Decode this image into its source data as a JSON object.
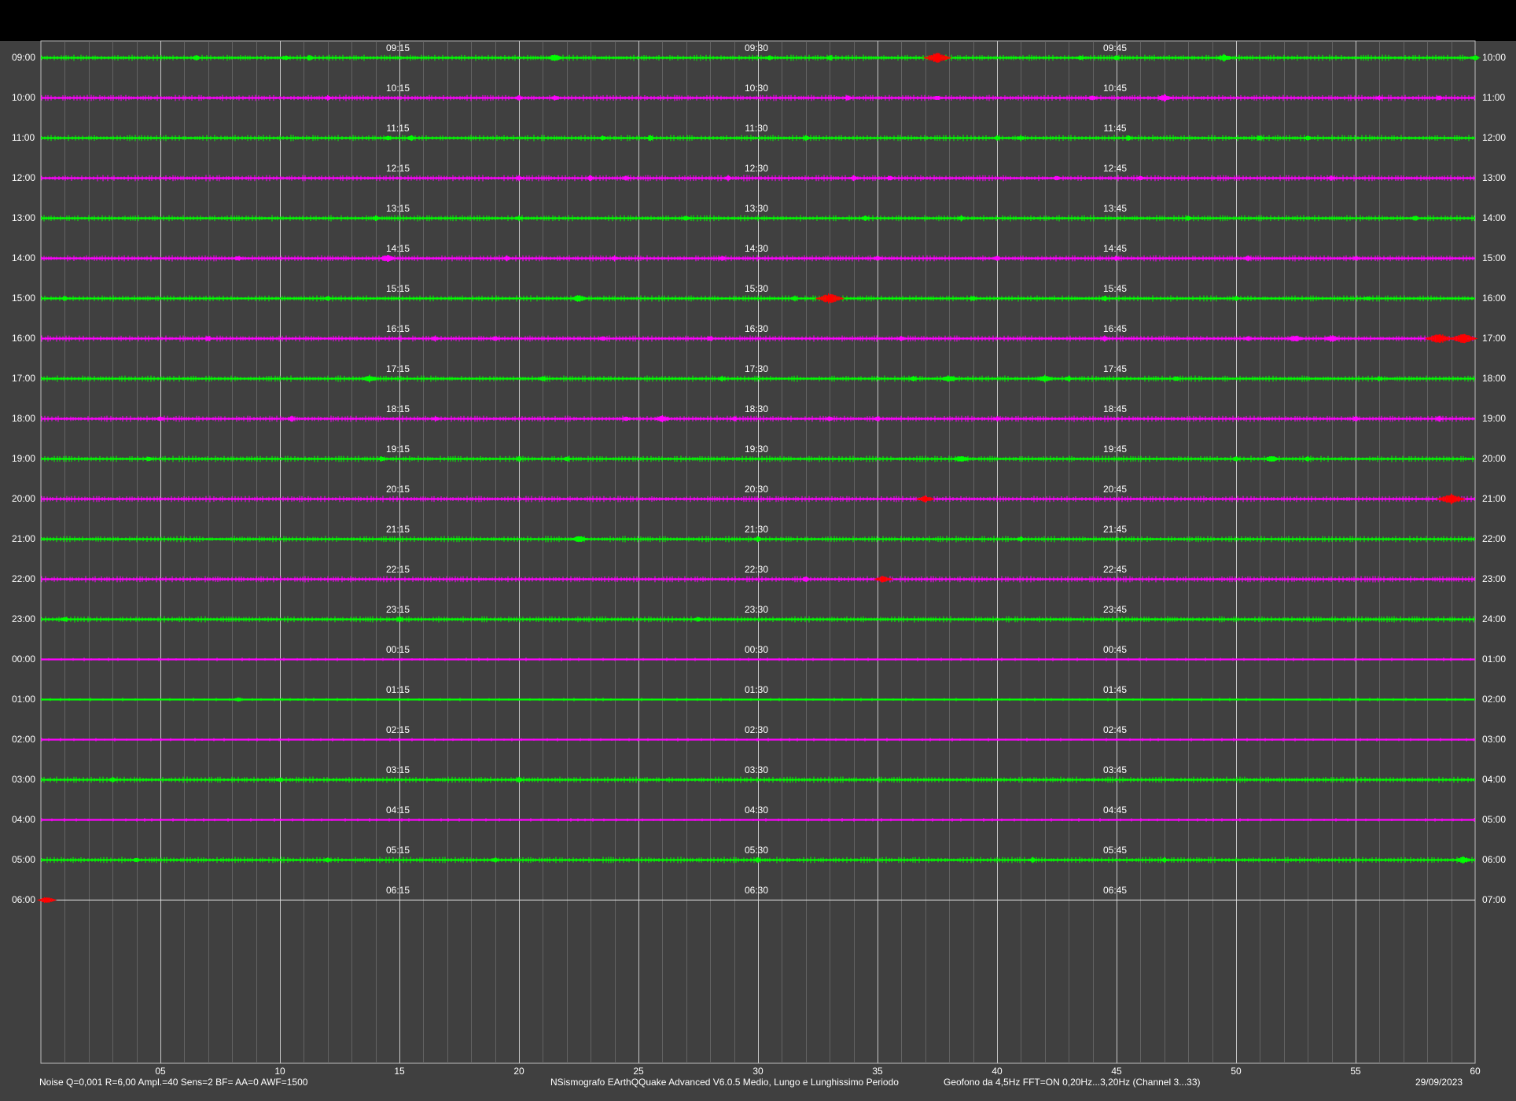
{
  "chart_data": {
    "type": "line",
    "x_ticks": [
      "05",
      "10",
      "15",
      "20",
      "25",
      "30",
      "35",
      "40",
      "45",
      "50",
      "55",
      "60"
    ],
    "x_range_minutes": [
      0,
      60
    ],
    "rows": [
      {
        "left": "09:00",
        "right": "10:00",
        "q15": "09:15",
        "q30": "09:30",
        "q45": "09:45",
        "color": "#00ff00",
        "events": [
          [
            13,
            1
          ],
          [
            20.5,
            1
          ],
          [
            22.5,
            1
          ],
          [
            43,
            2
          ],
          [
            61,
            1
          ],
          [
            66,
            1
          ],
          [
            75,
            3
          ],
          [
            87,
            1
          ],
          [
            90,
            1
          ],
          [
            99,
            2
          ],
          [
            120,
            1
          ]
        ]
      },
      {
        "left": "10:00",
        "right": "11:00",
        "q15": "10:15",
        "q30": "10:30",
        "q45": "10:45",
        "color": "#ff00ff",
        "events": [
          [
            24,
            1
          ],
          [
            40,
            1
          ],
          [
            43,
            1
          ],
          [
            67.5,
            1
          ],
          [
            75,
            1
          ],
          [
            88,
            1
          ],
          [
            94,
            2
          ],
          [
            112,
            1
          ],
          [
            117,
            1
          ]
        ]
      },
      {
        "left": "11:00",
        "right": "12:00",
        "q15": "11:15",
        "q30": "11:30",
        "q45": "11:45",
        "color": "#00ff00",
        "events": [
          [
            29,
            1
          ],
          [
            31,
            1
          ],
          [
            47,
            1
          ],
          [
            51,
            1
          ],
          [
            64,
            1
          ],
          [
            80,
            1
          ],
          [
            82,
            1
          ],
          [
            91,
            1
          ],
          [
            102,
            1
          ],
          [
            106,
            1
          ]
        ]
      },
      {
        "left": "12:00",
        "right": "13:00",
        "q15": "12:15",
        "q30": "12:30",
        "q45": "12:45",
        "color": "#ff00ff",
        "events": [
          [
            40,
            1
          ],
          [
            46,
            1
          ],
          [
            49,
            1
          ],
          [
            57.5,
            1
          ],
          [
            68,
            1
          ],
          [
            71,
            1
          ],
          [
            85,
            1
          ],
          [
            92,
            1
          ],
          [
            108,
            1
          ]
        ]
      },
      {
        "left": "13:00",
        "right": "14:00",
        "q15": "13:15",
        "q30": "13:30",
        "q45": "13:45",
        "color": "#00ff00",
        "events": [
          [
            28,
            1
          ],
          [
            40,
            1
          ],
          [
            54,
            1
          ],
          [
            69,
            1
          ],
          [
            77,
            1
          ],
          [
            96,
            1
          ],
          [
            115,
            1
          ]
        ]
      },
      {
        "left": "14:00",
        "right": "15:00",
        "q15": "14:15",
        "q30": "14:30",
        "q45": "14:45",
        "color": "#ff00ff",
        "events": [
          [
            16.5,
            1
          ],
          [
            29,
            2
          ],
          [
            39,
            1
          ],
          [
            48,
            1
          ],
          [
            57,
            1
          ],
          [
            70,
            1
          ],
          [
            80,
            1
          ],
          [
            90,
            1
          ],
          [
            101,
            1
          ],
          [
            110,
            1
          ]
        ]
      },
      {
        "left": "15:00",
        "right": "16:00",
        "q15": "15:15",
        "q30": "15:30",
        "q45": "15:45",
        "color": "#00ff00",
        "events": [
          [
            2,
            1
          ],
          [
            24,
            1
          ],
          [
            45,
            2
          ],
          [
            63,
            1
          ],
          [
            66,
            3
          ],
          [
            78,
            1
          ],
          [
            89,
            1
          ],
          [
            100,
            1
          ],
          [
            111,
            1
          ]
        ]
      },
      {
        "left": "16:00",
        "right": "17:00",
        "q15": "16:15",
        "q30": "16:30",
        "q45": "16:45",
        "color": "#ff00ff",
        "events": [
          [
            14,
            1
          ],
          [
            33,
            1
          ],
          [
            38,
            1
          ],
          [
            47,
            1
          ],
          [
            56,
            1
          ],
          [
            72,
            1
          ],
          [
            89,
            1
          ],
          [
            101,
            1
          ],
          [
            105,
            2
          ],
          [
            108,
            2
          ],
          [
            117,
            3
          ],
          [
            119,
            3
          ]
        ]
      },
      {
        "left": "17:00",
        "right": "18:00",
        "q15": "17:15",
        "q30": "17:30",
        "q45": "17:45",
        "color": "#00ff00",
        "events": [
          [
            27.5,
            2
          ],
          [
            42,
            1
          ],
          [
            57,
            1
          ],
          [
            73,
            1
          ],
          [
            76,
            2
          ],
          [
            84,
            2
          ],
          [
            86,
            1
          ],
          [
            95,
            1
          ],
          [
            112,
            1
          ]
        ]
      },
      {
        "left": "18:00",
        "right": "19:00",
        "q15": "18:15",
        "q30": "18:30",
        "q45": "18:45",
        "color": "#ff00ff",
        "events": [
          [
            10,
            1
          ],
          [
            21,
            1
          ],
          [
            33,
            1
          ],
          [
            49,
            1
          ],
          [
            52,
            2
          ],
          [
            58,
            1
          ],
          [
            66,
            1
          ],
          [
            70,
            1
          ],
          [
            80,
            1
          ],
          [
            110,
            1
          ],
          [
            117,
            1
          ]
        ]
      },
      {
        "left": "19:00",
        "right": "20:00",
        "q15": "19:15",
        "q30": "19:30",
        "q45": "19:45",
        "color": "#00ff00",
        "events": [
          [
            9,
            1
          ],
          [
            28.5,
            1
          ],
          [
            40,
            1
          ],
          [
            44,
            1
          ],
          [
            77,
            2
          ],
          [
            100,
            1
          ],
          [
            103,
            2
          ],
          [
            106,
            1
          ]
        ]
      },
      {
        "left": "20:00",
        "right": "21:00",
        "q15": "20:15",
        "q30": "20:30",
        "q45": "20:45",
        "color": "#ff00ff",
        "events": [
          [
            74,
            2
          ],
          [
            118,
            3
          ]
        ]
      },
      {
        "left": "21:00",
        "right": "22:00",
        "q15": "21:15",
        "q30": "21:30",
        "q45": "21:45",
        "color": "#00ff00",
        "events": [
          [
            45,
            2
          ],
          [
            60,
            1
          ],
          [
            82,
            1
          ]
        ]
      },
      {
        "left": "22:00",
        "right": "23:00",
        "q15": "22:15",
        "q30": "22:30",
        "q45": "22:45",
        "color": "#ff00ff",
        "events": [
          [
            64,
            1
          ],
          [
            70.5,
            2
          ]
        ]
      },
      {
        "left": "23:00",
        "right": "24:00",
        "q15": "23:15",
        "q30": "23:30",
        "q45": "23:45",
        "color": "#00ff00",
        "events": [
          [
            2,
            1
          ],
          [
            30,
            1
          ],
          [
            55,
            1
          ]
        ]
      },
      {
        "left": "00:00",
        "right": "01:00",
        "q15": "00:15",
        "q30": "00:30",
        "q45": "00:45",
        "color": "#ff00ff",
        "events": []
      },
      {
        "left": "01:00",
        "right": "02:00",
        "q15": "01:15",
        "q30": "01:30",
        "q45": "01:45",
        "color": "#00ff00",
        "events": [
          [
            16.5,
            1
          ]
        ]
      },
      {
        "left": "02:00",
        "right": "03:00",
        "q15": "02:15",
        "q30": "02:30",
        "q45": "02:45",
        "color": "#ff00ff",
        "events": []
      },
      {
        "left": "03:00",
        "right": "04:00",
        "q15": "03:15",
        "q30": "03:30",
        "q45": "03:45",
        "color": "#00ff00",
        "events": [
          [
            6,
            1
          ],
          [
            20,
            1
          ],
          [
            40,
            1
          ]
        ]
      },
      {
        "left": "04:00",
        "right": "05:00",
        "q15": "04:15",
        "q30": "04:30",
        "q45": "04:45",
        "color": "#ff00ff",
        "events": []
      },
      {
        "left": "05:00",
        "right": "06:00",
        "q15": "05:15",
        "q30": "05:30",
        "q45": "05:45",
        "color": "#00ff00",
        "events": [
          [
            8,
            1
          ],
          [
            24,
            1
          ],
          [
            38,
            1
          ],
          [
            60,
            1
          ],
          [
            83,
            1
          ],
          [
            94,
            1
          ],
          [
            119,
            2
          ]
        ]
      },
      {
        "left": "06:00",
        "right": "07:00",
        "q15": "06:15",
        "q30": "06:30",
        "q45": "06:45",
        "color": "#ff00ff",
        "events": [
          [
            0.5,
            2
          ]
        ]
      }
    ]
  },
  "footer": {
    "left": "Noise Q=0,001 R=6,00 Ampl.=40 Sens=2 BF= AA=0 AWF=1500",
    "center": "NSismografo  EArthQQuake Advanced V6.0.5  Medio, Lungo e Lunghissimo Periodo",
    "right": "Geofono da 4,5Hz FFT=ON 0,20Hz...3,20Hz      (Channel 3...33)",
    "date": "29/09/2023"
  },
  "colors": {
    "background": "#404040",
    "trace_a": "#00ff00",
    "trace_b": "#ff00ff",
    "event_peak": "#ff0000",
    "grid": "#cfcfcf"
  }
}
